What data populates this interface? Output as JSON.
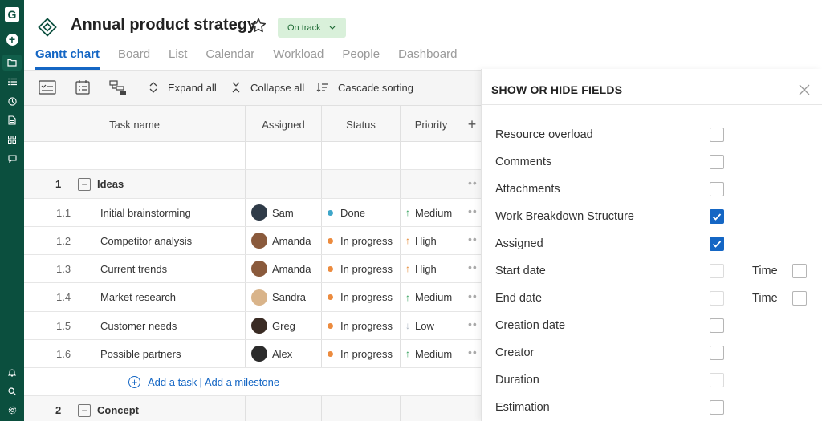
{
  "rail": {
    "logo": "G",
    "icons": [
      "plus-icon",
      "folder-icon",
      "list-icon",
      "clock-icon",
      "document-icon",
      "grid-icon",
      "chat-icon",
      "bell-icon",
      "search-icon",
      "settings-icon"
    ]
  },
  "project": {
    "title": "Annual product strategy",
    "status": "On track",
    "accent": "#1466c4",
    "brand": "#0b4f3e"
  },
  "tabs": {
    "gantt": "Gantt chart",
    "board": "Board",
    "list": "List",
    "calendar": "Calendar",
    "workload": "Workload",
    "people": "People",
    "dashboard": "Dashboard"
  },
  "toolbar": {
    "expand": "Expand all",
    "collapse": "Collapse all",
    "cascade": "Cascade sorting"
  },
  "columns": {
    "task": "Task name",
    "assigned": "Assigned",
    "status": "Status",
    "priority": "Priority"
  },
  "groups": [
    {
      "num": "1",
      "name": "Ideas"
    },
    {
      "num": "2",
      "name": "Concept"
    }
  ],
  "tasks": [
    {
      "num": "1.1",
      "name": "Initial brainstorming",
      "assignee": "Sam",
      "status": "Done",
      "priority": "Medium"
    },
    {
      "num": "1.2",
      "name": "Competitor analysis",
      "assignee": "Amanda",
      "status": "In progress",
      "priority": "High"
    },
    {
      "num": "1.3",
      "name": "Current trends",
      "assignee": "Amanda",
      "status": "In progress",
      "priority": "High"
    },
    {
      "num": "1.4",
      "name": "Market research",
      "assignee": "Sandra",
      "status": "In progress",
      "priority": "Medium"
    },
    {
      "num": "1.5",
      "name": "Customer needs",
      "assignee": "Greg",
      "status": "In progress",
      "priority": "Low"
    },
    {
      "num": "1.6",
      "name": "Possible partners",
      "assignee": "Alex",
      "status": "In progress",
      "priority": "Medium"
    }
  ],
  "add": {
    "task": "Add a task",
    "separator": "|",
    "milestone": "Add a milestone"
  },
  "panel": {
    "title": "SHOW OR HIDE FIELDS",
    "time_label": "Time",
    "fields": [
      {
        "label": "Resource overload",
        "checked": false
      },
      {
        "label": "Comments",
        "checked": false
      },
      {
        "label": "Attachments",
        "checked": false
      },
      {
        "label": "Work Breakdown Structure",
        "checked": true
      },
      {
        "label": "Assigned",
        "checked": true
      },
      {
        "label": "Start date",
        "checked": false
      },
      {
        "label": "End date",
        "checked": false
      },
      {
        "label": "Creation date",
        "checked": false
      },
      {
        "label": "Creator",
        "checked": false
      },
      {
        "label": "Duration",
        "checked": false
      },
      {
        "label": "Estimation",
        "checked": false
      }
    ]
  }
}
